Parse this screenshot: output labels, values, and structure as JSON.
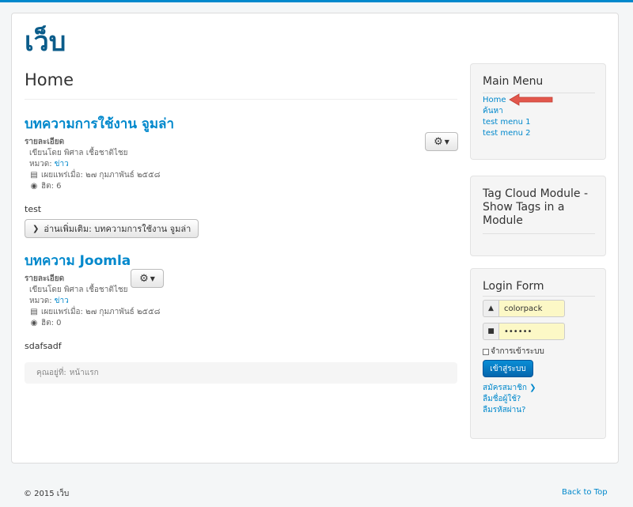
{
  "site": {
    "title": "เว็บ"
  },
  "page": {
    "heading": "Home"
  },
  "articles": [
    {
      "title": "บทความการใช้งาน จูมล่า",
      "details_label": "รายละเอียด",
      "author": "เขียนโดย พิศาล เชื้อชาติไชย",
      "category_label": "หมวด:",
      "category": "ข่าว",
      "published": "เผยแพร่เมื่อ: ๒๗ กุมภาพันธ์ ๒๕๕๘",
      "hits": "ฮิต: 6",
      "intro": "test",
      "read_more": "อ่านเพิ่มเติม: บทความการใช้งาน จูมล่า"
    },
    {
      "title": "บทความ Joomla",
      "details_label": "รายละเอียด",
      "author": "เขียนโดย พิศาล เชื้อชาติไชย",
      "category_label": "หมวด:",
      "category": "ข่าว",
      "published": "เผยแพร่เมื่อ: ๒๗ กุมภาพันธ์ ๒๕๕๘",
      "hits": "ฮิต: 0",
      "intro": "sdafsadf"
    }
  ],
  "breadcrumbs": {
    "label": "คุณอยู่ที่:",
    "current": "หน้าแรก"
  },
  "main_menu": {
    "title": "Main Menu",
    "items": [
      "Home",
      "ค้นหา",
      "test menu 1",
      "test menu 2"
    ]
  },
  "tag_cloud": {
    "title": "Tag Cloud Module - Show Tags in a Module"
  },
  "login": {
    "title": "Login Form",
    "username": "colorpack",
    "password": "••••••",
    "remember": "จำการเข้าระบบ",
    "submit": "เข้าสู่ระบบ",
    "register": "สมัครสมาชิก",
    "forgot_username": "ลืมชื่อผู้ใช้?",
    "forgot_password": "ลืมรหัสผ่าน?"
  },
  "footer": {
    "copyright": "© 2015 เว็บ",
    "back_to_top": "Back to Top"
  },
  "colors": {
    "accent": "#0088cc",
    "annotation_arrow": "#e2574c"
  },
  "icons": [
    "gear-icon",
    "calendar-icon",
    "eye-icon",
    "chevron-right-icon",
    "user-icon",
    "lock-icon"
  ]
}
